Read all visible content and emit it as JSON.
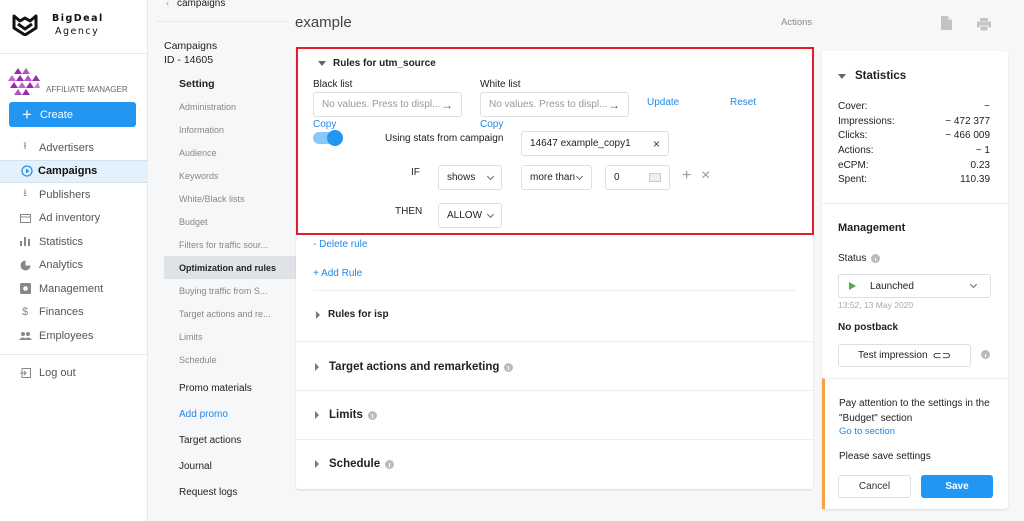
{
  "brand": {
    "line1": "BigDeal",
    "line2": "Agency"
  },
  "role": "AFFILIATE MANAGER",
  "create_label": "Create",
  "nav": [
    {
      "label": "Advertisers",
      "icon": "upload-icon",
      "active": false
    },
    {
      "label": "Campaigns",
      "icon": "play-circle-icon",
      "active": true
    },
    {
      "label": "Publishers",
      "icon": "download-icon",
      "active": false
    },
    {
      "label": "Ad inventory",
      "icon": "inventory-icon",
      "active": false
    },
    {
      "label": "Statistics",
      "icon": "bar-chart-icon",
      "active": false
    },
    {
      "label": "Analytics",
      "icon": "pie-chart-icon",
      "active": false
    },
    {
      "label": "Management",
      "icon": "gear-box-icon",
      "active": false
    },
    {
      "label": "Finances",
      "icon": "dollar-icon",
      "active": false
    },
    {
      "label": "Employees",
      "icon": "people-icon",
      "active": false
    }
  ],
  "logout_label": "Log out",
  "subnav": {
    "back_label": "campaigns",
    "title": "Campaigns",
    "id_label": "ID - 14605",
    "setting_label": "Setting",
    "setting_items": [
      "Administration",
      "Information",
      "Audience",
      "Keywords",
      "White/Black lists",
      "Budget",
      "Filters for traffic sour...",
      "Optimization and rules",
      "Buying traffic from S...",
      "Target actions and re...",
      "Limits",
      "Schedule"
    ],
    "active_item": "Optimization and rules",
    "promo_label": "Promo materials",
    "add_promo": "Add promo",
    "target_actions": "Target actions",
    "journal": "Journal",
    "request_logs": "Request logs"
  },
  "header": {
    "title": "example",
    "actions": "Actions"
  },
  "rules": {
    "section_title": "Rules for utm_source",
    "black_list_label": "Black list",
    "black_list_placeholder": "No values. Press to displ...",
    "white_list_label": "White list",
    "white_list_placeholder": "No values. Press to displ...",
    "update": "Update",
    "reset": "Reset",
    "copy": "Copy",
    "toggle_on": true,
    "stats_label": "Using stats from campaign",
    "stats_campaign": "14647 example_copy1",
    "if_label": "IF",
    "if_metric": "shows",
    "if_operator": "more than",
    "if_value": "0",
    "then_label": "THEN",
    "then_action": "ALLOW",
    "delete_rule": "- Delete rule",
    "add_rule": "+ Add Rule",
    "isp_title": "Rules for isp"
  },
  "sections": [
    {
      "label": "Target actions and remarketing"
    },
    {
      "label": "Limits"
    },
    {
      "label": "Schedule"
    }
  ],
  "statistics": {
    "title": "Statistics",
    "rows": [
      {
        "label": "Cover:",
        "value": "~"
      },
      {
        "label": "Impressions:",
        "value": "~ 472 377"
      },
      {
        "label": "Clicks:",
        "value": "~ 466 009"
      },
      {
        "label": "Actions:",
        "value": "~ 1"
      },
      {
        "label": "eCPM:",
        "value": "0.23"
      },
      {
        "label": "Spent:",
        "value": "110.39"
      }
    ]
  },
  "management": {
    "title": "Management",
    "status_label": "Status",
    "status_value": "Launched",
    "status_time": "13:52, 13 May 2020",
    "postback": "No postback",
    "test_impression": "Test impression"
  },
  "warning": {
    "text": "Pay attention to the settings in the \"Budget\" section",
    "link": "Go to section",
    "save_note": "Please save settings",
    "cancel": "Cancel",
    "save": "Save"
  },
  "colors": {
    "accent": "#2196f3",
    "highlight": "#e21c2a",
    "warning": "#f5a245",
    "launched": "#4caf50"
  }
}
